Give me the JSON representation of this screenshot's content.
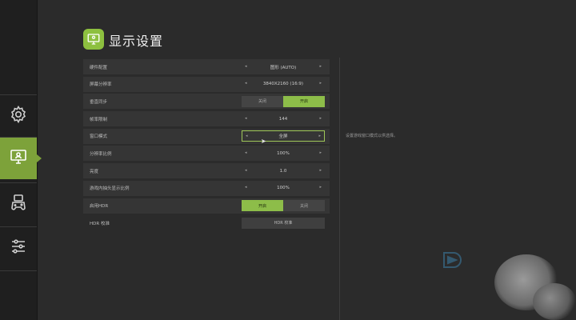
{
  "header": {
    "title": "显示设置",
    "icon": "monitor-icon"
  },
  "nav": {
    "items": [
      {
        "icon": "gear-icon",
        "active": false
      },
      {
        "icon": "monitor-icon",
        "active": true
      },
      {
        "icon": "gamepad-icon",
        "active": false
      },
      {
        "icon": "sliders-icon",
        "active": false
      }
    ]
  },
  "settings": {
    "rows": [
      {
        "label": "硬件配置",
        "type": "select",
        "value": "图形 (AUTO)"
      },
      {
        "label": "屏幕分辨率",
        "type": "select",
        "value": "3840X2160 (16:9)"
      },
      {
        "label": "垂直同步",
        "type": "toggle",
        "options": [
          "关闭",
          "开启"
        ],
        "selected": 1
      },
      {
        "label": "帧率限制",
        "type": "select",
        "value": "144"
      },
      {
        "label": "窗口模式",
        "type": "select",
        "value": "全屏",
        "focused": true
      },
      {
        "label": "分辨率比例",
        "type": "select",
        "value": "100%"
      },
      {
        "label": "亮度",
        "type": "select",
        "value": "1.0"
      },
      {
        "label": "游戏内抽头显示比例",
        "type": "select",
        "value": "100%"
      },
      {
        "label": "启用HDR",
        "type": "toggle",
        "options": [
          "开启",
          "关闭"
        ],
        "selected": 0
      },
      {
        "label": "HDR 校准",
        "type": "button",
        "value": "HDR 校准"
      }
    ]
  },
  "description": {
    "text": "设置游戏窗口模式以供选择。"
  },
  "colors": {
    "accent": "#8dc03f",
    "background": "#2b2b2b",
    "row": "#353535"
  }
}
